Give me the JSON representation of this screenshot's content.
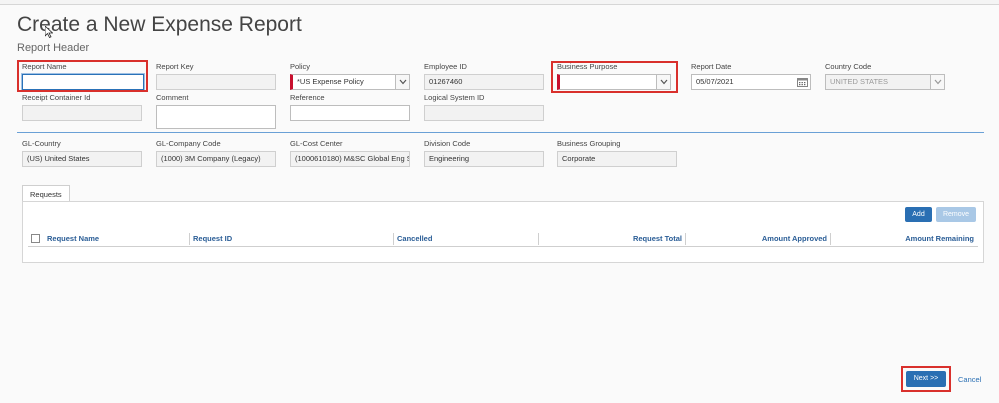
{
  "page": {
    "title": "Create a New Expense Report",
    "subtitle": "Report Header"
  },
  "header_fields": {
    "report_name": {
      "label": "Report Name",
      "value": ""
    },
    "report_key": {
      "label": "Report Key",
      "value": ""
    },
    "policy": {
      "label": "Policy",
      "value": "*US Expense Policy"
    },
    "employee_id": {
      "label": "Employee ID",
      "value": "01267460"
    },
    "business_purpose": {
      "label": "Business Purpose",
      "value": ""
    },
    "report_date": {
      "label": "Report Date",
      "value": "05/07/2021"
    },
    "country_code": {
      "label": "Country Code",
      "value": "UNITED STATES"
    },
    "receipt_container_id": {
      "label": "Receipt Container Id",
      "value": ""
    },
    "comment": {
      "label": "Comment",
      "value": ""
    },
    "reference": {
      "label": "Reference",
      "value": ""
    },
    "logical_system_id": {
      "label": "Logical System ID",
      "value": ""
    }
  },
  "gl_fields": {
    "gl_country": {
      "label": "GL-Country",
      "value": "(US) United States"
    },
    "gl_company_code": {
      "label": "GL-Company Code",
      "value": "(1000) 3M Company (Legacy)"
    },
    "gl_cost_center": {
      "label": "GL-Cost Center",
      "value": "(1000610180) M&SC Global Eng Sy"
    },
    "division_code": {
      "label": "Division Code",
      "value": "Engineering"
    },
    "business_grouping": {
      "label": "Business Grouping",
      "value": "Corporate"
    }
  },
  "requests": {
    "tab_label": "Requests",
    "add_label": "Add",
    "remove_label": "Remove",
    "columns": [
      "Request Name",
      "Request ID",
      "Cancelled",
      "Request Total",
      "Amount Approved",
      "Amount Remaining"
    ]
  },
  "footer": {
    "next_label": "Next >>",
    "cancel_label": "Cancel"
  },
  "colors": {
    "accent": "#2a6fb3",
    "required": "#c8102e",
    "highlight": "#d9302c"
  }
}
